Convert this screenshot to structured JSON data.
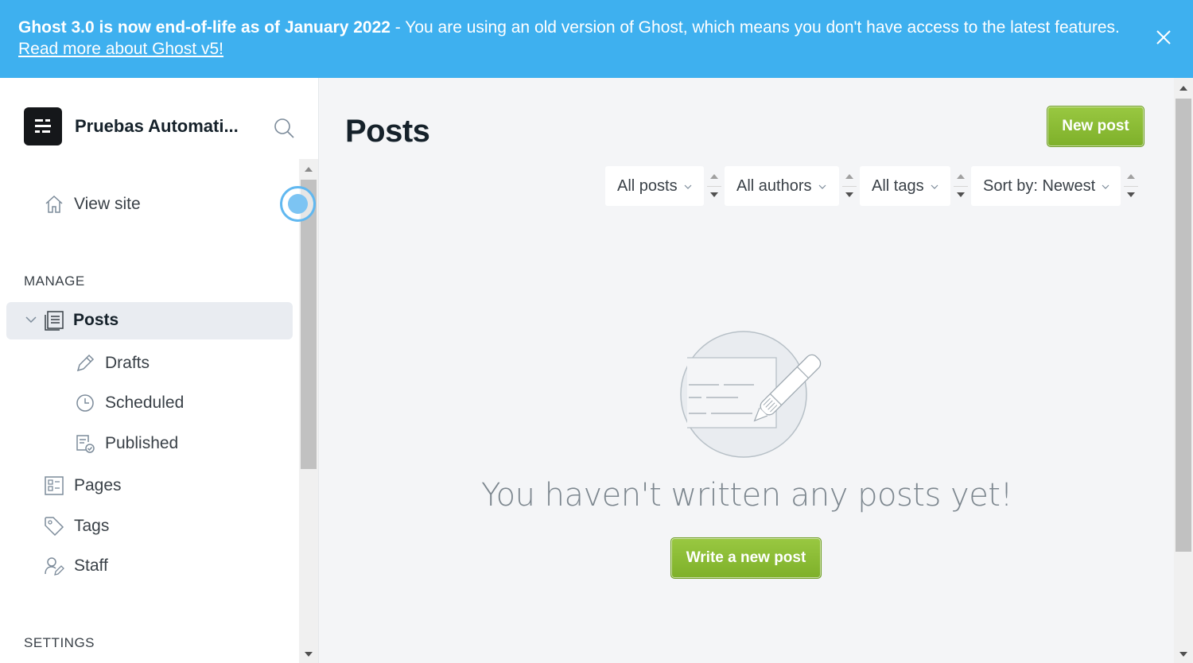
{
  "banner": {
    "bold_text": "Ghost 3.0 is now end-of-life as of January 2022",
    "message": " - You are using an old version of Ghost, which means you don't have access to the latest features. ",
    "link_text": "Read more about Ghost v5!",
    "close_icon": "close-icon",
    "color": "#3eb0ef"
  },
  "sidebar": {
    "site_name": "Pruebas Automati...",
    "view_site": "View site",
    "manage_label": "MANAGE",
    "settings_label": "SETTINGS",
    "posts": {
      "label": "Posts",
      "subitems": [
        {
          "label": "Drafts",
          "icon": "pencil-icon"
        },
        {
          "label": "Scheduled",
          "icon": "clock-icon"
        },
        {
          "label": "Published",
          "icon": "published-icon"
        }
      ]
    },
    "items": [
      {
        "label": "Pages",
        "icon": "pages-icon"
      },
      {
        "label": "Tags",
        "icon": "tag-icon"
      },
      {
        "label": "Staff",
        "icon": "staff-icon"
      }
    ]
  },
  "main": {
    "title": "Posts",
    "new_post_label": "New post",
    "filters": {
      "type": "All posts",
      "author": "All authors",
      "tag": "All tags",
      "sort": "Sort by: Newest"
    },
    "empty_message": "You haven't written any posts yet!",
    "write_post_label": "Write a new post",
    "accent_color": "#7eb02a"
  }
}
